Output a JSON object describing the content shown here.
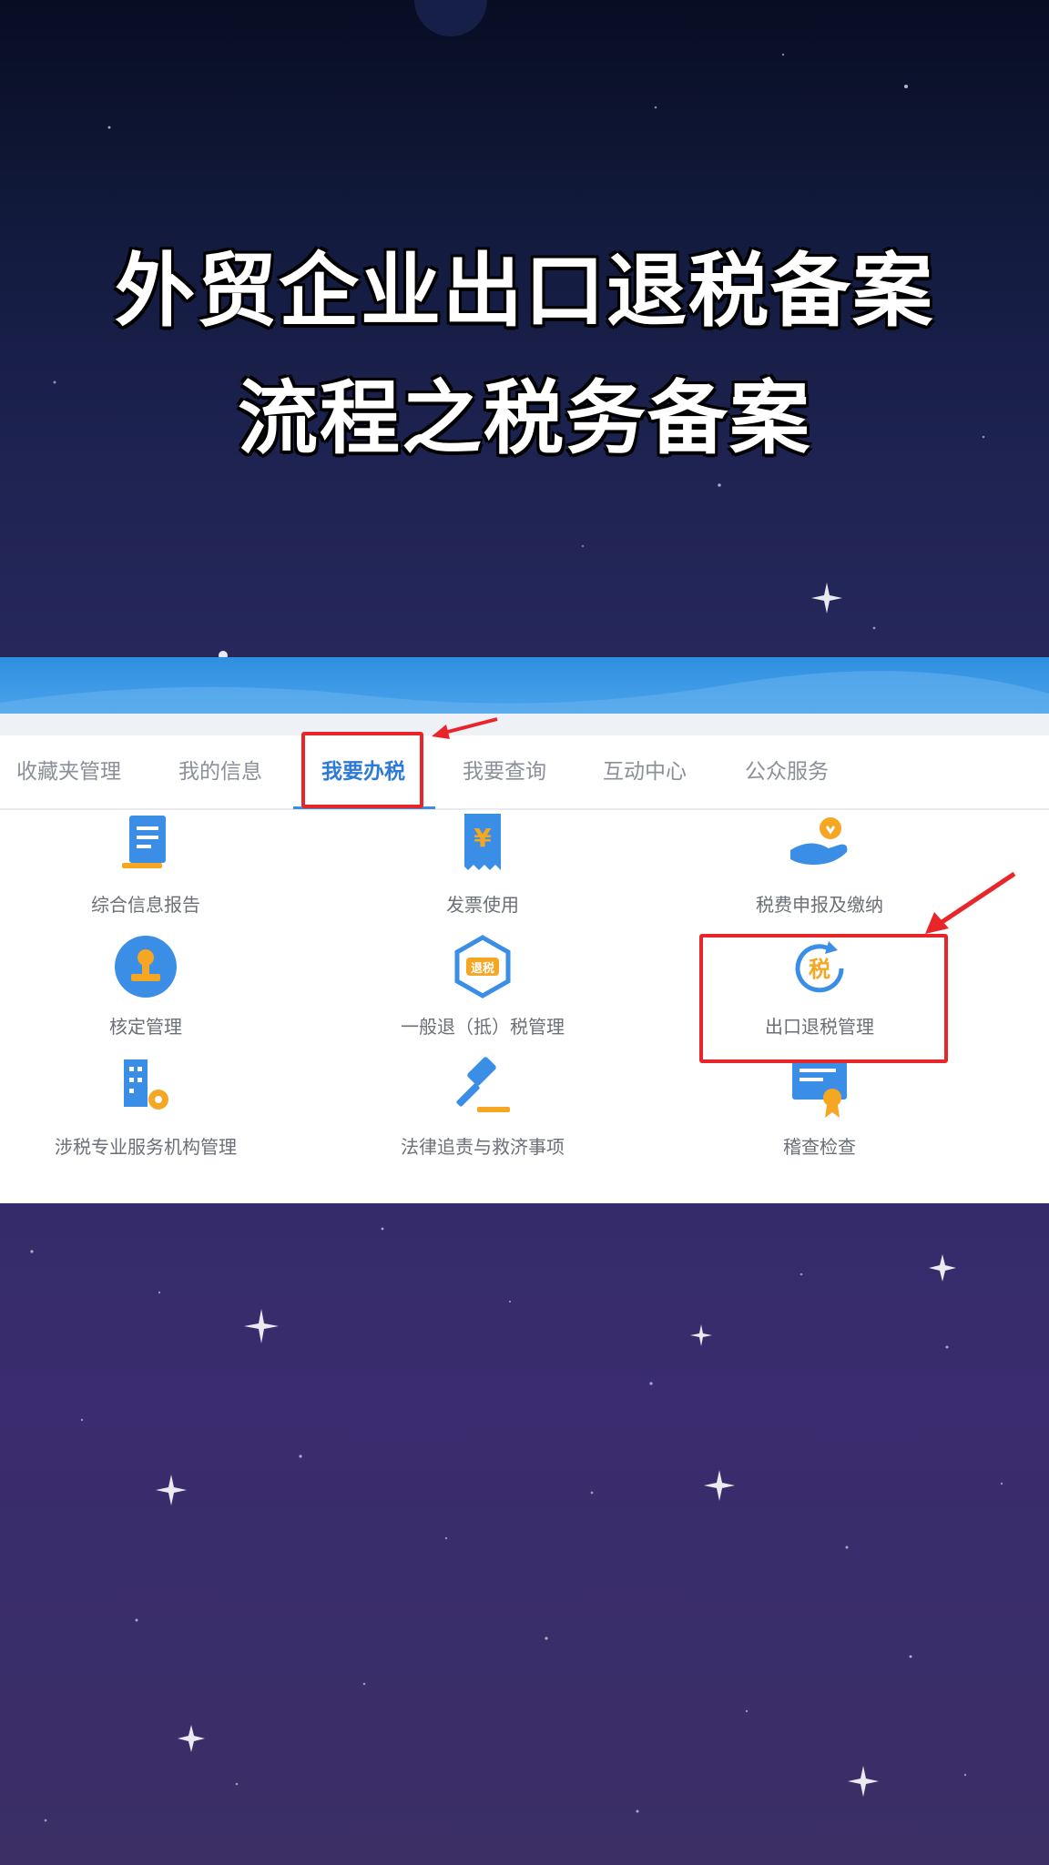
{
  "headline": {
    "line1": "外贸企业出口退税备案",
    "line2": "流程之税务备案"
  },
  "tabs": [
    {
      "label": "收藏夹管理",
      "active": false
    },
    {
      "label": "我的信息",
      "active": false
    },
    {
      "label": "我要办税",
      "active": true
    },
    {
      "label": "我要查询",
      "active": false
    },
    {
      "label": "互动中心",
      "active": false
    },
    {
      "label": "公众服务",
      "active": false
    }
  ],
  "services": [
    {
      "label": "综合信息报告",
      "icon": "document-icon"
    },
    {
      "label": "发票使用",
      "icon": "invoice-yuan-icon"
    },
    {
      "label": "税费申报及缴纳",
      "icon": "hand-coin-icon"
    },
    {
      "label": "核定管理",
      "icon": "stamp-icon"
    },
    {
      "label": "一般退（抵）税管理",
      "icon": "refund-badge-icon"
    },
    {
      "label": "出口退税管理",
      "icon": "tax-refresh-icon",
      "icon_text": "税"
    },
    {
      "label": "涉税专业服务机构管理",
      "icon": "building-gear-icon"
    },
    {
      "label": "法律追责与救济事项",
      "icon": "gavel-icon"
    },
    {
      "label": "稽查检查",
      "icon": "certificate-icon"
    }
  ],
  "refund_badge_text": "退税",
  "colors": {
    "accent": "#2d7bd6",
    "highlight": "#e8262a",
    "icon_orange": "#f5a623",
    "icon_blue": "#3a8ee6"
  }
}
